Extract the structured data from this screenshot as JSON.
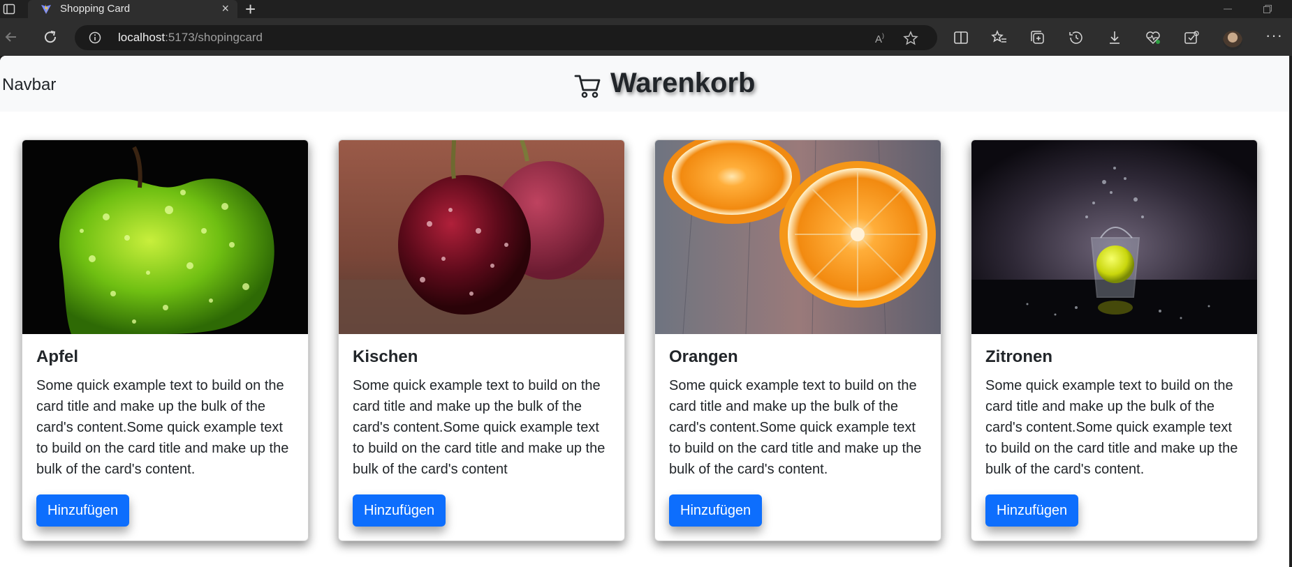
{
  "browser": {
    "tab_title": "Shopping Card",
    "tab_close": "×",
    "new_tab": "+",
    "url_host": "localhost",
    "url_path": ":5173/shopingcard",
    "more": "···"
  },
  "page": {
    "navbar_brand": "Navbar",
    "heading": "Warenkorb",
    "accent_color": "#0d6efd"
  },
  "cards": [
    {
      "title": "Apfel",
      "text": "Some quick example text to build on the card title and make up the bulk of the card's content.Some quick example text to build on the card title and make up the bulk of the card's content.",
      "button": "Hinzufügen"
    },
    {
      "title": "Kischen",
      "text": "Some quick example text to build on the card title and make up the bulk of the card's content.Some quick example text to build on the card title and make up the bulk of the card's content",
      "button": "Hinzufügen"
    },
    {
      "title": "Orangen",
      "text": "Some quick example text to build on the card title and make up the bulk of the card's content.Some quick example text to build on the card title and make up the bulk of the card's content.",
      "button": "Hinzufügen"
    },
    {
      "title": "Zitronen",
      "text": "Some quick example text to build on the card title and make up the bulk of the card's content.Some quick example text to build on the card title and make up the bulk of the card's content.",
      "button": "Hinzufügen"
    }
  ]
}
